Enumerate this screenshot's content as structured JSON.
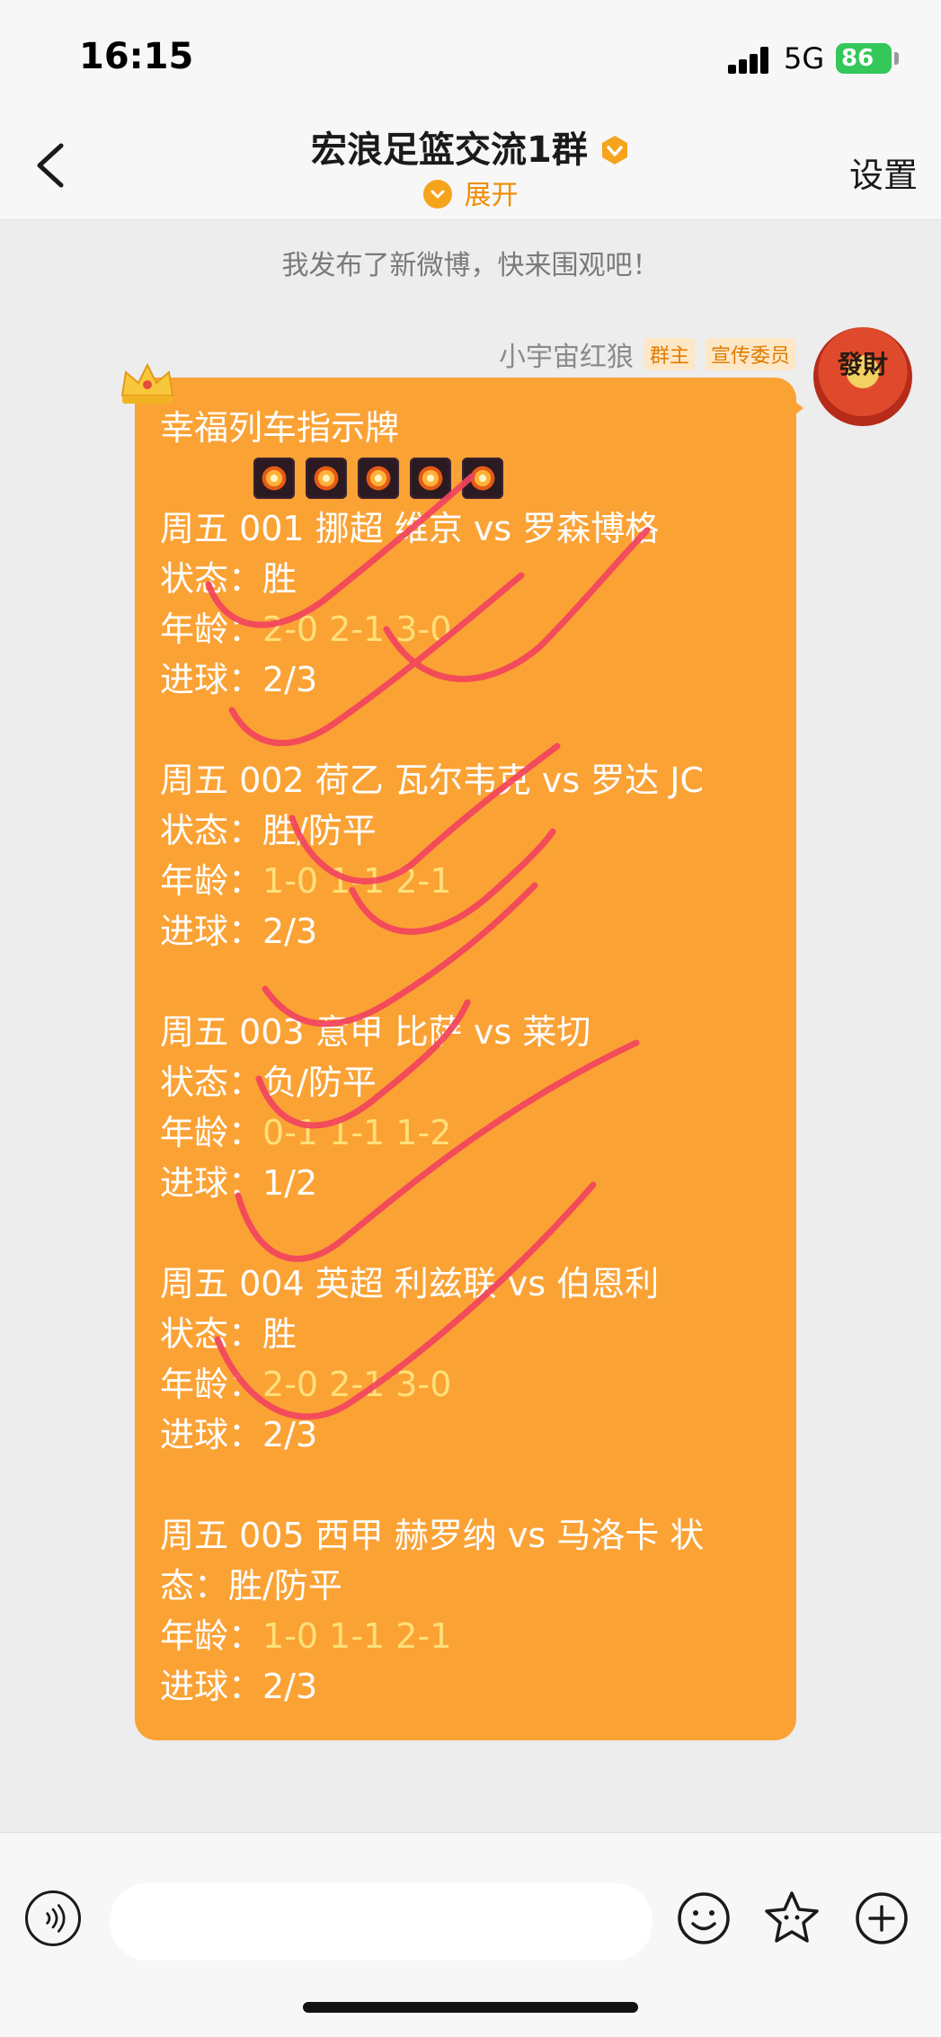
{
  "status_bar": {
    "time": "16:15",
    "network": "5G",
    "battery": "86"
  },
  "header": {
    "title": "宏浪足篮交流1群",
    "expand_label": "展开",
    "settings_label": "设置"
  },
  "chat": {
    "system_message": "我发布了新微博，快来围观吧！",
    "sender": {
      "name": "小宇宙红狼",
      "role_tag": "群主",
      "title_tag": "宣传委员",
      "avatar_text": "發財"
    },
    "message": {
      "title": "幸福列车指示牌",
      "matches": [
        {
          "header": "周五 001 挪超 维京 vs 罗森博格",
          "status": "状态：胜",
          "age_label": "年龄：",
          "age_values": "2-0 2-1 3-0",
          "goals": "进球：2/3"
        },
        {
          "header": "周五 002 荷乙 瓦尔韦克 vs 罗达 JC",
          "status": "状态：胜/防平",
          "age_label": "年龄：",
          "age_values": "1-0 1-1 2-1",
          "goals": "进球：2/3"
        },
        {
          "header": "周五 003 意甲 比萨 vs 莱切",
          "status": "状态：负/防平",
          "age_label": "年龄：",
          "age_values": "0-1 1-1 1-2",
          "goals": "进球：1/2"
        },
        {
          "header": "周五 004  英超  利兹联 vs 伯恩利",
          "status": "状态：胜",
          "age_label": "年龄：",
          "age_values": "2-0 2-1 3-0",
          "goals": "进球：2/3"
        }
      ],
      "last_match": {
        "header": "周五 005 西甲 赫罗纳 vs 马洛卡 状",
        "status": "态：胜/防平",
        "age_label": "年龄：",
        "age_values": "1-0 1-1 2-1",
        "goals": "进球：2/3"
      }
    }
  },
  "input_bar": {
    "placeholder": ""
  },
  "colors": {
    "bubble": "#fba235",
    "age_highlight": "#ffe079",
    "scribble": "#f2445e",
    "accent": "#f08c00"
  },
  "icons": [
    "back-chevron-icon",
    "verified-badge-icon",
    "expand-chevron-icon",
    "crown-icon",
    "firework-icon",
    "voice-icon",
    "emoji-icon",
    "sticker-icon",
    "plus-icon"
  ]
}
